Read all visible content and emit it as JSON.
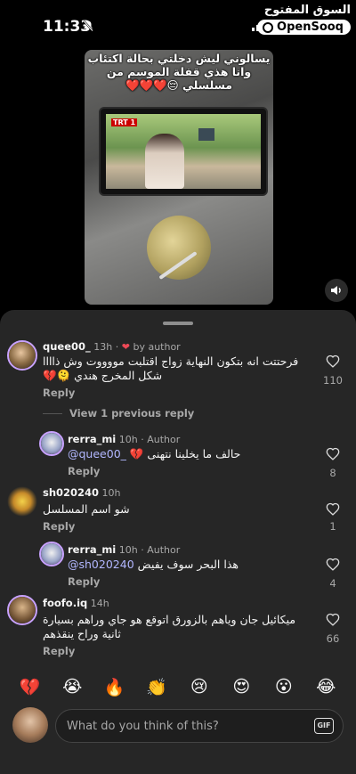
{
  "status_bar": {
    "time": "11:33",
    "brand_ar": "السوق المفتوح",
    "brand_en": "OpenSooq"
  },
  "video": {
    "caption": "يسالوني ليش دخلتي بحالة اكتئاب  وانا هذي قفلة الموسم من مسلسلي 😔❤️❤️❤️",
    "tv_logo": "TRT 1"
  },
  "comments": [
    {
      "user": "quee00_",
      "time": "13h",
      "author_tag": "by author",
      "text": "فرحتتت انه بتكون النهاية زواج اقتلبت مووووت وش ذاااا شكل المخرج هندي 🫠💔",
      "reply": "Reply",
      "likes": "110"
    },
    {
      "view_previous": "View 1 previous reply"
    },
    {
      "user": "rerra_mi",
      "time": "10h",
      "author_tag": "Author",
      "mention": "@quee00_",
      "text": "حالف ما يخلينا نتهنى 💔",
      "reply": "Reply",
      "likes": "8"
    },
    {
      "user": "sh020240",
      "time": "10h",
      "text": "شو اسم المسلسل",
      "reply": "Reply",
      "likes": "1"
    },
    {
      "user": "rerra_mi",
      "time": "10h",
      "author_tag": "Author",
      "mention": "@sh020240",
      "text": "هذا البحر سوف يفيض",
      "reply": "Reply",
      "likes": "4"
    },
    {
      "user": "foofo.iq",
      "time": "14h",
      "text": "ميكائيل جان وياهم بالزورق اتوقع هو جاي وراهم بسيارة ثانية وراح ينقذهم",
      "reply": "Reply",
      "likes": "66"
    }
  ],
  "emoji_bar": [
    "💔",
    "😭",
    "🔥",
    "👏",
    "😢",
    "😍",
    "😮",
    "😂"
  ],
  "composer": {
    "placeholder": "What do you think of this?",
    "gif_label": "GIF"
  },
  "icons": [
    "notification-muted-icon",
    "cellular-signal-icon",
    "wifi-icon",
    "speaker-icon",
    "heart-outline-icon",
    "red-heart-icon",
    "gif-icon"
  ]
}
